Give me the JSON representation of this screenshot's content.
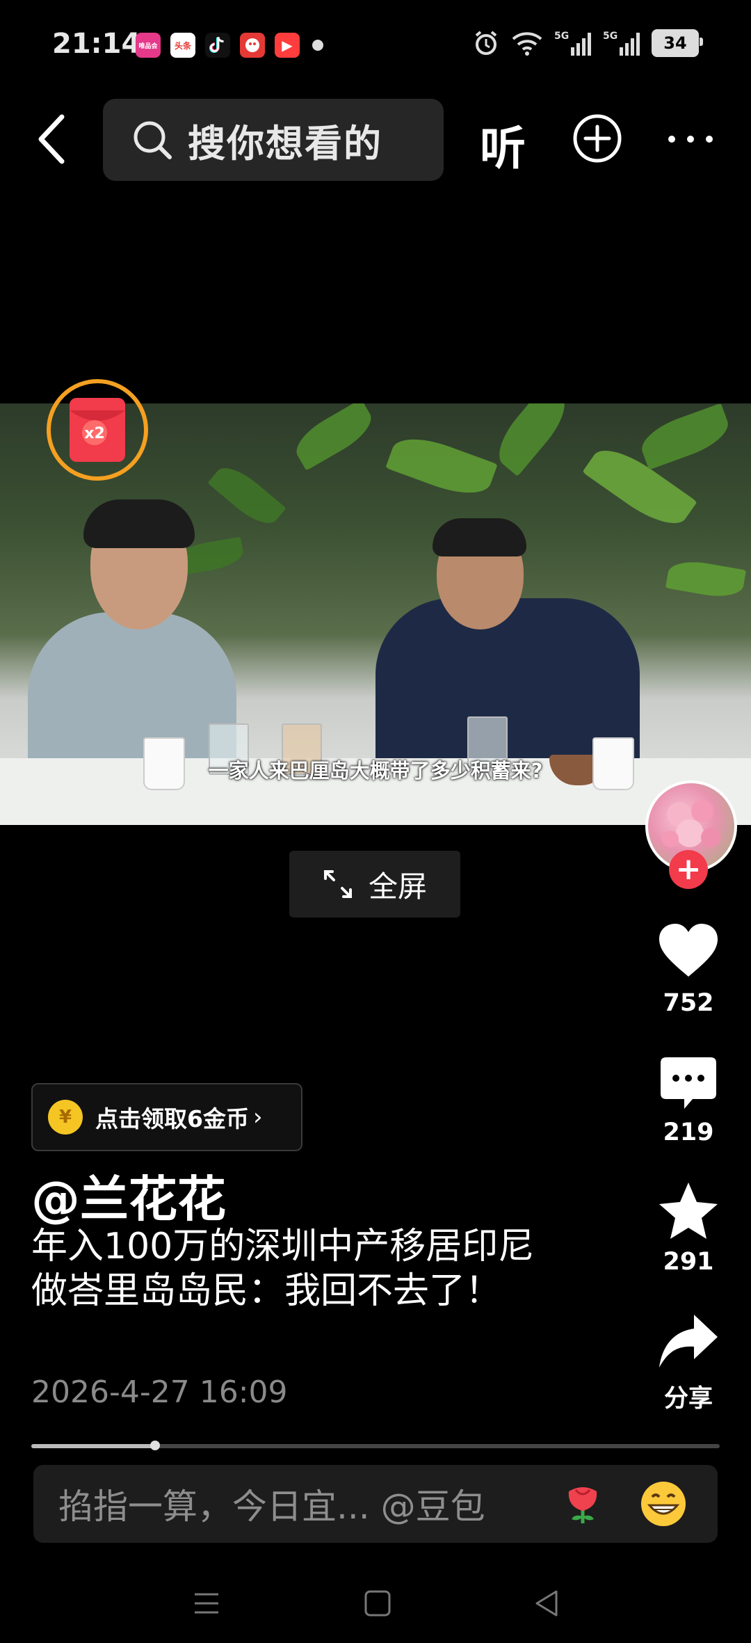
{
  "status_bar": {
    "time": "21:14",
    "app_icons": [
      {
        "name": "vip-app-icon",
        "label": "唯品会",
        "color": "#e6398a"
      },
      {
        "name": "toutiao-app-icon",
        "label": "头条",
        "color": "#e53935"
      },
      {
        "name": "douyin-app-icon",
        "label": "",
        "color": "#111111"
      },
      {
        "name": "game-app-icon",
        "label": "",
        "color": "#e53935"
      },
      {
        "name": "video-app-icon",
        "label": "▶",
        "color": "#ff3d3d"
      }
    ],
    "battery": "34"
  },
  "top_nav": {
    "search_placeholder": "搜你想看的",
    "listen_label": "听"
  },
  "video": {
    "subtitle": "一家人来巴厘岛大概带了多少积蓄来?",
    "coin_multiplier": "x2",
    "fullscreen_label": "全屏"
  },
  "right_rail": {
    "like_count": "752",
    "comment_count": "219",
    "favorite_count": "291",
    "share_label": "分享"
  },
  "info": {
    "coin_reward": "点击领取6金币",
    "author": "@兰花花",
    "caption": "年入100万的深圳中产移居印尼做峇里岛岛民：我回不去了！",
    "date": "2026-4-27 16:09"
  },
  "playback": {
    "progress": 0.18
  },
  "comment_bar": {
    "placeholder": "掐指一算，今日宜... @豆包"
  },
  "colors": {
    "accent_red": "#f23b4b",
    "timer_orange": "#f5a021",
    "coin_gold": "#f5c623"
  }
}
